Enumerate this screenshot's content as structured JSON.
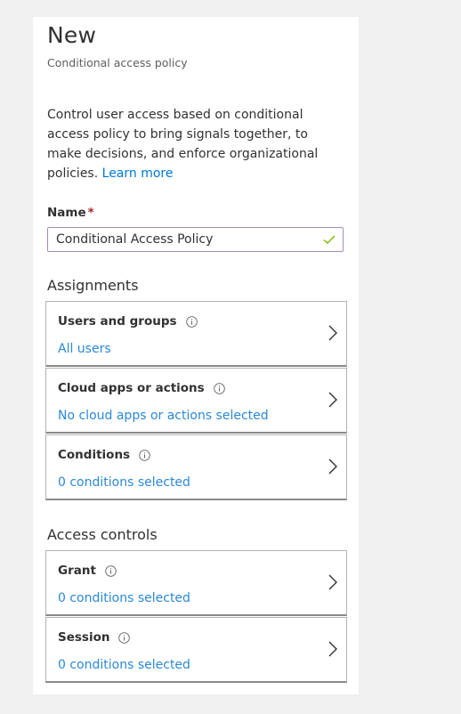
{
  "header": {
    "title": "New",
    "subtitle": "Conditional access policy"
  },
  "description": {
    "text": "Control user access based on conditional access policy to bring signals together, to make decisions, and enforce organizational policies. ",
    "link_label": "Learn more"
  },
  "name_field": {
    "label": "Name",
    "required_marker": "*",
    "value": "Conditional Access Policy",
    "valid_icon": "checkmark-icon"
  },
  "assignments": {
    "heading": "Assignments",
    "items": [
      {
        "title": "Users and groups",
        "value": "All users"
      },
      {
        "title": "Cloud apps or actions",
        "value": "No cloud apps or actions selected"
      },
      {
        "title": "Conditions",
        "value": "0 conditions selected"
      }
    ]
  },
  "access_controls": {
    "heading": "Access controls",
    "items": [
      {
        "title": "Grant",
        "value": "0 conditions selected"
      },
      {
        "title": "Session",
        "value": "0 conditions selected"
      }
    ]
  },
  "colors": {
    "link": "#2b88d8",
    "required": "#a4262c",
    "field_border": "#a58cc1",
    "check": "#7fba00"
  }
}
